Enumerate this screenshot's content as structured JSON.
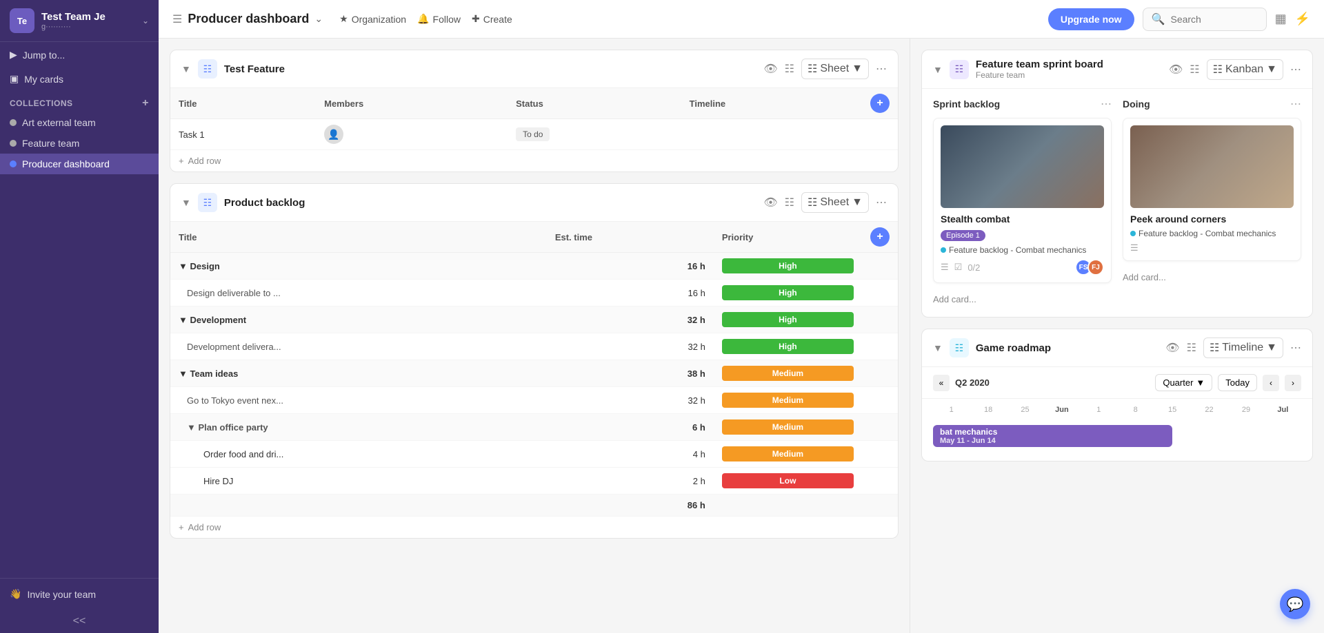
{
  "team": {
    "initials": "Te",
    "name": "Test Team Je",
    "subtitle": "g··········"
  },
  "sidebar": {
    "jump_label": "Jump to...",
    "my_cards_label": "My cards",
    "collections_label": "Collections",
    "items": [
      {
        "label": "Art external team",
        "color": "#aaa",
        "active": false
      },
      {
        "label": "Feature team",
        "color": "#aaa",
        "active": false
      },
      {
        "label": "Producer dashboard",
        "color": "#5b7fff",
        "active": true
      }
    ],
    "invite_label": "Invite your team",
    "collapse_label": "<<"
  },
  "topbar": {
    "title": "Producer dashboard",
    "follow_label": "Follow",
    "create_label": "Create",
    "upgrade_label": "Upgrade now",
    "search_placeholder": "Search"
  },
  "test_feature": {
    "title": "Test Feature",
    "view_label": "Sheet",
    "columns": [
      "Title",
      "Members",
      "Status",
      "Timeline"
    ],
    "rows": [
      {
        "title": "Task 1",
        "members": "",
        "status": "To do",
        "timeline": ""
      }
    ],
    "add_row_label": "Add row"
  },
  "product_backlog": {
    "title": "Product backlog",
    "view_label": "Sheet",
    "columns": [
      "Title",
      "Est. time",
      "Priority"
    ],
    "groups": [
      {
        "name": "Design",
        "est": "16 h",
        "priority": "High",
        "priority_class": "high",
        "children": [
          {
            "title": "Design deliverable to ...",
            "est": "16 h",
            "priority": "High",
            "priority_class": "high"
          }
        ]
      },
      {
        "name": "Development",
        "est": "32 h",
        "priority": "High",
        "priority_class": "high",
        "children": [
          {
            "title": "Development delivera...",
            "est": "32 h",
            "priority": "High",
            "priority_class": "high"
          }
        ]
      },
      {
        "name": "Team ideas",
        "est": "38 h",
        "priority": "Medium",
        "priority_class": "medium",
        "children": [
          {
            "title": "Go to Tokyo event nex...",
            "est": "32 h",
            "priority": "Medium",
            "priority_class": "medium"
          },
          {
            "title": "Plan office party",
            "est": "6 h",
            "priority": "Medium",
            "priority_class": "medium",
            "is_group": true,
            "children": [
              {
                "title": "Order food and dri...",
                "est": "4 h",
                "priority": "Medium",
                "priority_class": "medium"
              },
              {
                "title": "Hire DJ",
                "est": "2 h",
                "priority": "Low",
                "priority_class": "low"
              }
            ]
          }
        ]
      }
    ],
    "total_est": "86 h",
    "add_row_label": "Add row"
  },
  "sprint_board": {
    "title": "Feature team sprint board",
    "subtitle": "Feature team",
    "view_label": "Kanban",
    "columns": [
      {
        "name": "Sprint backlog",
        "cards": [
          {
            "title": "Stealth combat",
            "badge": "Episode 1",
            "tag": "Feature backlog - Combat mechanics",
            "has_text_icon": true,
            "checklist": "0/2",
            "avatars": [
              "FS",
              "FJ"
            ],
            "avatar_colors": [
              "#5b7fff",
              "#e07040"
            ]
          }
        ],
        "add_card_label": "Add card..."
      },
      {
        "name": "Doing",
        "cards": [
          {
            "title": "Peek around corners",
            "tag": "Feature backlog - Combat mechanics",
            "has_text_icon": true
          }
        ],
        "add_card_label": "Add card..."
      }
    ]
  },
  "game_roadmap": {
    "title": "Game roadmap",
    "view_label": "Timeline",
    "period": "Q2 2020",
    "quarter_label": "Quarter",
    "today_label": "Today",
    "dates": {
      "jun": [
        "1",
        "18",
        "25",
        "Jun",
        "1",
        "8",
        "15",
        "22",
        "29"
      ],
      "jul_label": "Jul"
    },
    "bar": {
      "label": "bat mechanics",
      "sublabel": "May 11 - Jun 14",
      "color": "#7c5cbf"
    }
  }
}
